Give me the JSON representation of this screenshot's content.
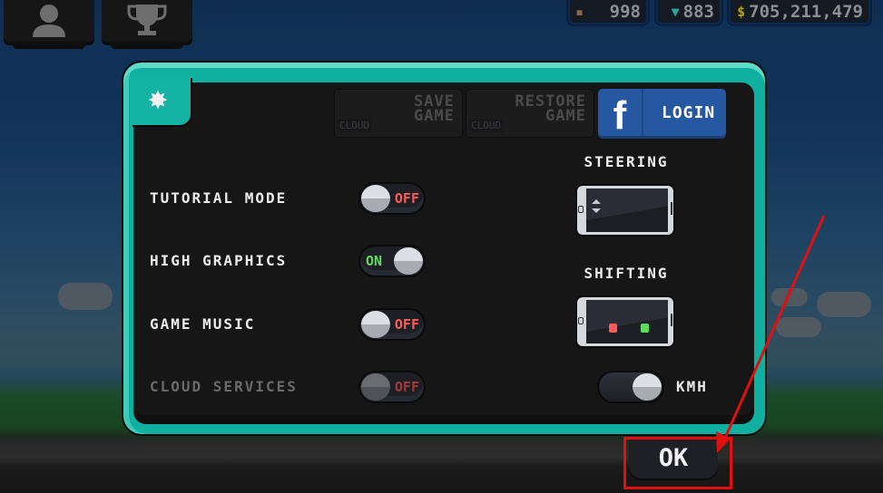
{
  "top_bar": {
    "profile_icon": "person-icon",
    "trophy_icon": "trophy-icon",
    "currencies": [
      {
        "name": "crates",
        "icon": "crate-icon",
        "symbol": "▪",
        "value": "998",
        "color": "#8a6a4a"
      },
      {
        "name": "gems",
        "icon": "gem-icon",
        "symbol": "▼",
        "value": "883",
        "color": "#2fa49a"
      },
      {
        "name": "cash",
        "icon": "dollar-icon",
        "symbol": "$",
        "value": "705,211,479",
        "color": "#b5a222"
      }
    ]
  },
  "settings_panel": {
    "gear_symbol": "✸",
    "cloud_buttons": [
      {
        "tag": "CLOUD",
        "title_line1": "SAVE",
        "title_line2": "GAME"
      },
      {
        "tag": "CLOUD",
        "title_line1": "RESTORE",
        "title_line2": "GAME"
      }
    ],
    "facebook": {
      "icon_letter": "f",
      "label": "LOGIN"
    },
    "settings": [
      {
        "label": "TUTORIAL MODE",
        "state": "OFF",
        "enabled": true
      },
      {
        "label": "HIGH GRAPHICS",
        "state": "ON",
        "enabled": true
      },
      {
        "label": "GAME MUSIC",
        "state": "OFF",
        "enabled": true
      },
      {
        "label": "CLOUD SERVICES",
        "state": "OFF",
        "enabled": false
      }
    ],
    "steering": {
      "label": "STEERING"
    },
    "shifting": {
      "label": "SHIFTING",
      "down_color": "#ff5a5a",
      "up_color": "#5cdc5c"
    },
    "units": {
      "label": "KMH"
    }
  },
  "ok_button": {
    "label": "OK"
  },
  "annotation": {
    "color": "#e01010"
  }
}
